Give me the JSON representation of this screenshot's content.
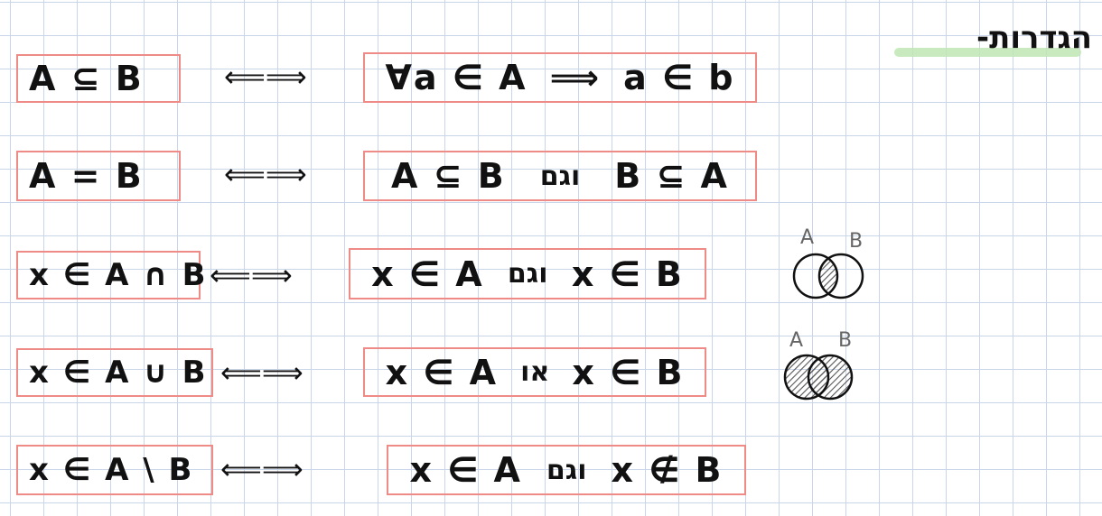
{
  "heading": "הגדרות-",
  "iff_symbol": "⟸⟹",
  "rows": [
    {
      "lhs": "A ⊆ B",
      "rhs": [
        "∀a ∈ A",
        "⟹",
        "a ∈ b"
      ]
    },
    {
      "lhs": "A = B",
      "rhs": [
        "A ⊆ B",
        "וגם",
        "B ⊆ A"
      ]
    },
    {
      "lhs": "x ∈ A ∩ B",
      "rhs": [
        "x ∈ A",
        "וגם",
        "x ∈ B"
      ]
    },
    {
      "lhs": "x ∈ A ∪ B",
      "rhs": [
        "x ∈ A",
        "או",
        "x ∈ B"
      ]
    },
    {
      "lhs": "x ∈ A \\ B",
      "rhs": [
        "x ∈ A",
        "וגם",
        "x ∉ B"
      ]
    }
  ],
  "venn": {
    "label_a": "A",
    "label_b": "B"
  }
}
